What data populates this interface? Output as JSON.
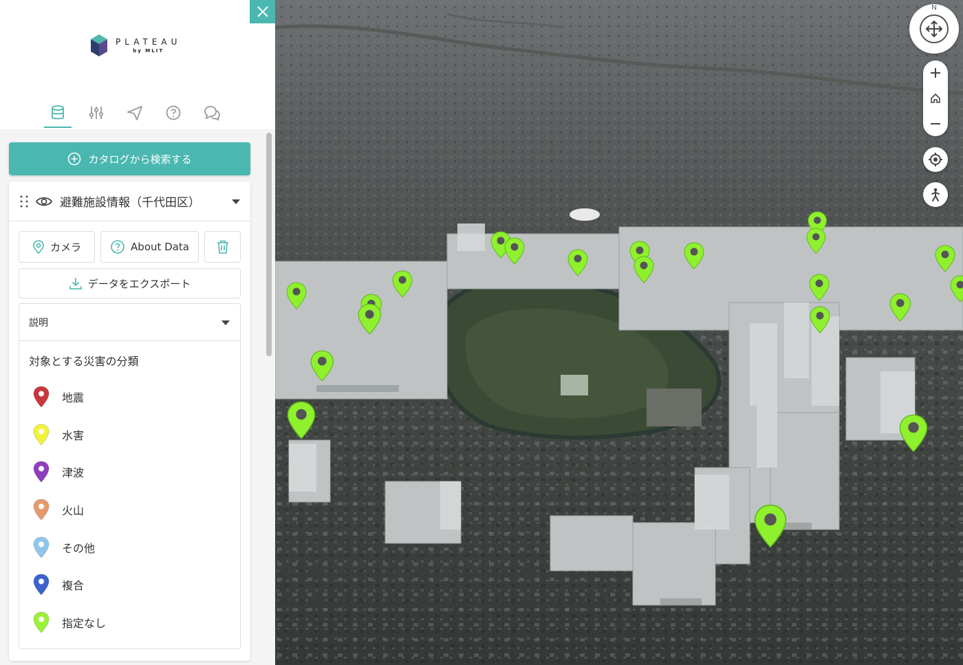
{
  "panel": {
    "logo": {
      "title": "PLATEAU",
      "subtitle": "by MLIT"
    },
    "tabs": [
      {
        "icon": "database-icon",
        "active": true
      },
      {
        "icon": "sliders-icon",
        "active": false
      },
      {
        "icon": "send-icon",
        "active": false
      },
      {
        "icon": "help-icon",
        "active": false
      },
      {
        "icon": "chat-icon",
        "active": false
      }
    ],
    "catalog_button": "カタログから検索する",
    "layer": {
      "title": "避難施設情報（千代田区）",
      "camera_label": "カメラ",
      "about_label": "About Data",
      "export_label": "データをエクスポート",
      "description": {
        "header": "説明",
        "title": "対象とする災害の分類",
        "legend": [
          {
            "label": "地震",
            "color": "#c8373b"
          },
          {
            "label": "水害",
            "color": "#f2f23c"
          },
          {
            "label": "津波",
            "color": "#8e3dbd"
          },
          {
            "label": "火山",
            "color": "#e69a6c"
          },
          {
            "label": "その他",
            "color": "#8fc7ea"
          },
          {
            "label": "複合",
            "color": "#3c62cf"
          },
          {
            "label": "指定なし",
            "color": "#9df03a"
          }
        ]
      }
    }
  },
  "map": {
    "compass_label": "N",
    "pin_color": "#8ff02e",
    "controls": [
      "zoom-in",
      "home",
      "zoom-out",
      "locate",
      "pedestrian"
    ]
  }
}
